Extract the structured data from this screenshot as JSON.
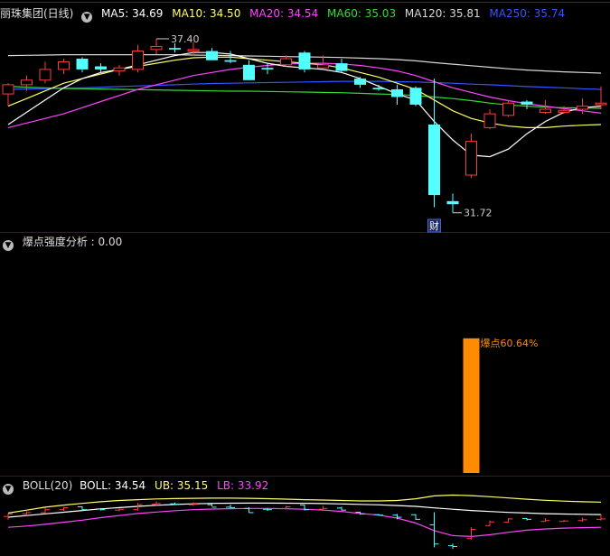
{
  "colors": {
    "up": "#ff3c3c",
    "down": "#54ffff",
    "ma5": "#ffffff",
    "ma10": "#ffff66",
    "ma20": "#ff44ff",
    "ma60": "#33dd33",
    "ma120": "#d8d8d8",
    "ma250": "#3355ff",
    "burst": "#ff8c00",
    "grid": "#7a0000"
  },
  "main_header": {
    "title": "丽珠集团(日线)",
    "ma5": "MA5: 34.69",
    "ma10": "MA10: 34.50",
    "ma20": "MA20: 34.54",
    "ma60": "MA60: 35.03",
    "ma120": "MA120: 35.81",
    "ma250": "MA250: 35.74"
  },
  "sub_header": {
    "title": "爆点强度分析 : 0.00"
  },
  "boll_header": {
    "title": "BOLL(20)",
    "boll": "BOLL: 34.54",
    "ub": "UB: 35.15",
    "lb": "LB: 33.92"
  },
  "chart_data": [
    {
      "type": "candlestick",
      "title": "丽珠集团(日线)",
      "y_range": [
        31.3,
        37.9
      ],
      "high_label": "37.40",
      "low_label": "31.72",
      "marker": "财",
      "candles": [
        {
          "o": 35.6,
          "h": 35.95,
          "l": 35.2,
          "c": 35.9
        },
        {
          "o": 35.9,
          "h": 36.2,
          "l": 35.7,
          "c": 36.05
        },
        {
          "o": 36.05,
          "h": 36.65,
          "l": 35.95,
          "c": 36.4
        },
        {
          "o": 36.4,
          "h": 36.75,
          "l": 36.25,
          "c": 36.65
        },
        {
          "o": 36.75,
          "h": 36.8,
          "l": 36.3,
          "c": 36.4
        },
        {
          "o": 36.5,
          "h": 36.6,
          "l": 36.3,
          "c": 36.4
        },
        {
          "o": 36.35,
          "h": 36.55,
          "l": 36.2,
          "c": 36.45
        },
        {
          "o": 36.4,
          "h": 37.2,
          "l": 36.3,
          "c": 37.0
        },
        {
          "o": 37.05,
          "h": 37.4,
          "l": 36.9,
          "c": 37.15
        },
        {
          "o": 37.1,
          "h": 37.25,
          "l": 36.95,
          "c": 37.05
        },
        {
          "o": 37.0,
          "h": 37.3,
          "l": 36.85,
          "c": 37.05
        },
        {
          "o": 37.0,
          "h": 37.1,
          "l": 36.8,
          "c": 36.7
        },
        {
          "o": 36.7,
          "h": 37.0,
          "l": 36.6,
          "c": 36.65
        },
        {
          "o": 36.55,
          "h": 36.7,
          "l": 36.05,
          "c": 36.05
        },
        {
          "o": 36.45,
          "h": 36.6,
          "l": 36.25,
          "c": 36.4
        },
        {
          "o": 36.55,
          "h": 36.85,
          "l": 36.5,
          "c": 36.75
        },
        {
          "o": 36.95,
          "h": 37.0,
          "l": 36.3,
          "c": 36.4
        },
        {
          "o": 36.45,
          "h": 36.85,
          "l": 36.45,
          "c": 36.55
        },
        {
          "o": 36.6,
          "h": 36.75,
          "l": 36.3,
          "c": 36.35
        },
        {
          "o": 36.1,
          "h": 36.15,
          "l": 35.8,
          "c": 35.9
        },
        {
          "o": 35.8,
          "h": 35.9,
          "l": 35.7,
          "c": 35.75
        },
        {
          "o": 35.75,
          "h": 35.9,
          "l": 35.25,
          "c": 35.5
        },
        {
          "o": 35.8,
          "h": 35.85,
          "l": 35.2,
          "c": 35.25
        },
        {
          "o": 34.6,
          "h": 36.1,
          "l": 31.9,
          "c": 32.3
        },
        {
          "o": 32.1,
          "h": 32.35,
          "l": 31.72,
          "c": 32.0
        },
        {
          "o": 32.95,
          "h": 34.3,
          "l": 32.85,
          "c": 34.05
        },
        {
          "o": 34.5,
          "h": 35.1,
          "l": 34.45,
          "c": 34.95
        },
        {
          "o": 34.9,
          "h": 35.4,
          "l": 34.85,
          "c": 35.3
        },
        {
          "o": 35.35,
          "h": 35.4,
          "l": 35.1,
          "c": 35.25
        },
        {
          "o": 35.0,
          "h": 35.4,
          "l": 34.95,
          "c": 35.1
        },
        {
          "o": 35.0,
          "h": 35.2,
          "l": 34.95,
          "c": 35.05
        },
        {
          "o": 35.1,
          "h": 35.45,
          "l": 34.95,
          "c": 35.2
        },
        {
          "o": 35.25,
          "h": 35.85,
          "l": 35.1,
          "c": 35.3
        }
      ],
      "series": [
        {
          "name": "MA5",
          "values": [
            34.6,
            35.0,
            35.4,
            35.8,
            36.1,
            36.3,
            36.4,
            36.55,
            36.7,
            36.85,
            36.95,
            36.95,
            36.9,
            36.75,
            36.6,
            36.5,
            36.45,
            36.4,
            36.3,
            36.1,
            35.85,
            35.6,
            35.4,
            34.7,
            34.1,
            33.6,
            33.55,
            33.8,
            34.3,
            34.7,
            35.0,
            35.15,
            35.2
          ]
        },
        {
          "name": "MA10",
          "values": [
            35.2,
            35.45,
            35.7,
            35.95,
            36.1,
            36.25,
            36.4,
            36.5,
            36.6,
            36.7,
            36.78,
            36.8,
            36.8,
            36.75,
            36.7,
            36.65,
            36.6,
            36.55,
            36.45,
            36.3,
            36.15,
            35.95,
            35.75,
            35.4,
            35.05,
            34.8,
            34.65,
            34.55,
            34.5,
            34.5,
            34.55,
            34.58,
            34.6
          ]
        },
        {
          "name": "MA20",
          "values": [
            34.5,
            34.65,
            34.8,
            34.95,
            35.15,
            35.35,
            35.55,
            35.75,
            35.9,
            36.05,
            36.2,
            36.3,
            36.4,
            36.47,
            36.53,
            36.58,
            36.6,
            36.6,
            36.58,
            36.53,
            36.45,
            36.35,
            36.2,
            36.0,
            35.8,
            35.65,
            35.5,
            35.38,
            35.28,
            35.2,
            35.12,
            35.05,
            34.97
          ]
        },
        {
          "name": "MA60",
          "values": [
            35.85,
            35.82,
            35.8,
            35.78,
            35.77,
            35.76,
            35.75,
            35.74,
            35.73,
            35.72,
            35.71,
            35.7,
            35.69,
            35.69,
            35.68,
            35.67,
            35.66,
            35.65,
            35.64,
            35.62,
            35.6,
            35.58,
            35.55,
            35.5,
            35.45,
            35.38,
            35.3,
            35.24,
            35.2,
            35.17,
            35.15,
            35.14,
            35.13
          ]
        },
        {
          "name": "MA120",
          "values": [
            36.85,
            36.86,
            36.87,
            36.88,
            36.88,
            36.88,
            36.88,
            36.88,
            36.88,
            36.88,
            36.87,
            36.86,
            36.85,
            36.84,
            36.83,
            36.82,
            36.81,
            36.8,
            36.79,
            36.77,
            36.75,
            36.72,
            36.68,
            36.62,
            36.57,
            36.52,
            36.47,
            36.42,
            36.38,
            36.35,
            36.32,
            36.3,
            36.28
          ]
        },
        {
          "name": "MA250",
          "values": [
            35.75,
            35.76,
            35.77,
            35.79,
            35.8,
            35.82,
            35.84,
            35.86,
            35.88,
            35.9,
            35.92,
            35.94,
            35.95,
            35.96,
            35.97,
            35.98,
            35.99,
            36.0,
            36.01,
            36.01,
            36.01,
            36.0,
            35.99,
            35.97,
            35.95,
            35.92,
            35.9,
            35.87,
            35.84,
            35.82,
            35.8,
            35.77,
            35.75
          ]
        }
      ]
    },
    {
      "type": "bar",
      "title": "爆点强度分析",
      "y_range": [
        0,
        100
      ],
      "bars": [
        {
          "index": 25,
          "value": 60.64,
          "label": "爆点60.64%"
        }
      ]
    },
    {
      "type": "line",
      "title": "BOLL(20)",
      "y_range": [
        31.3,
        38.2
      ],
      "series": [
        {
          "name": "UB",
          "values": [
            36.0,
            36.35,
            36.7,
            36.95,
            37.15,
            37.35,
            37.5,
            37.6,
            37.68,
            37.73,
            37.76,
            37.78,
            37.78,
            37.76,
            37.72,
            37.66,
            37.6,
            37.55,
            37.5,
            37.45,
            37.45,
            37.5,
            37.7,
            38.05,
            38.15,
            38.08,
            37.95,
            37.8,
            37.65,
            37.52,
            37.42,
            37.35,
            37.3
          ]
        },
        {
          "name": "BOLL",
          "values": [
            35.5,
            35.7,
            35.9,
            36.1,
            36.3,
            36.5,
            36.65,
            36.8,
            36.93,
            37.03,
            37.1,
            37.15,
            37.18,
            37.19,
            37.19,
            37.18,
            37.16,
            37.13,
            37.09,
            37.04,
            36.98,
            36.9,
            36.8,
            36.62,
            36.45,
            36.3,
            36.18,
            36.08,
            36.0,
            35.93,
            35.88,
            35.85,
            35.82
          ]
        },
        {
          "name": "LB",
          "values": [
            34.3,
            34.45,
            34.65,
            34.9,
            35.15,
            35.45,
            35.7,
            35.95,
            36.12,
            36.28,
            36.4,
            36.48,
            36.52,
            36.55,
            36.55,
            36.52,
            36.45,
            36.35,
            36.2,
            35.95,
            35.75,
            35.4,
            34.8,
            33.9,
            33.3,
            33.2,
            33.4,
            33.7,
            33.95,
            34.1,
            34.2,
            34.25,
            34.3
          ]
        }
      ]
    }
  ]
}
